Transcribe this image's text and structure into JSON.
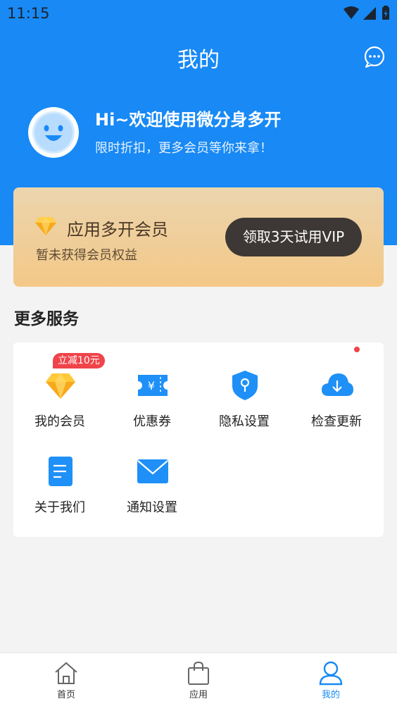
{
  "status_bar": {
    "time": "11:15"
  },
  "header": {
    "title": "我的",
    "message_icon": "chat-bubble-icon"
  },
  "user": {
    "avatar_icon": "smiley-avatar-icon",
    "greeting": "Hi~欢迎使用微分身多开",
    "subgreeting": "限时折扣，更多会员等你来拿！"
  },
  "vip": {
    "title": "应用多开会员",
    "subtitle": "暂未获得会员权益",
    "button": "领取3天试用VIP",
    "icon": "diamond-icon"
  },
  "services": {
    "title": "更多服务",
    "items": [
      {
        "label": "我的会员",
        "icon": "diamond-icon",
        "badge": "立减10元"
      },
      {
        "label": "优惠券",
        "icon": "coupon-icon"
      },
      {
        "label": "隐私设置",
        "icon": "shield-icon"
      },
      {
        "label": "检查更新",
        "icon": "cloud-download-icon",
        "has_dot": true
      },
      {
        "label": "关于我们",
        "icon": "document-icon"
      },
      {
        "label": "通知设置",
        "icon": "envelope-icon"
      }
    ]
  },
  "bottom_nav": {
    "items": [
      {
        "label": "首页",
        "icon": "home-icon",
        "active": false
      },
      {
        "label": "应用",
        "icon": "shopping-bag-icon",
        "active": false
      },
      {
        "label": "我的",
        "icon": "user-icon",
        "active": true
      }
    ]
  },
  "colors": {
    "primary": "#1889f5",
    "vip_gold": "#f3c887",
    "badge_red": "#f0434a"
  }
}
